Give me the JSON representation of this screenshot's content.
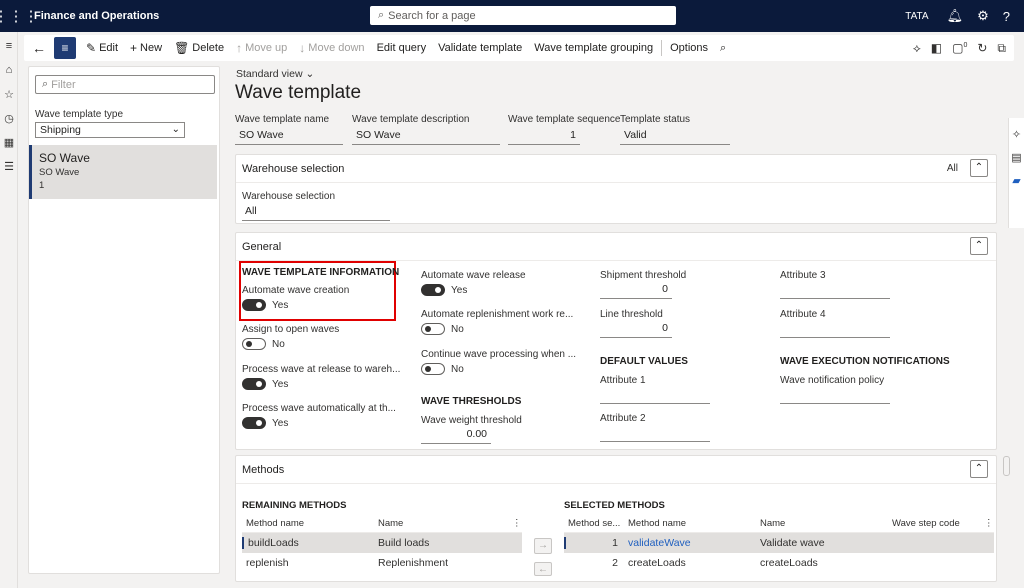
{
  "app": {
    "title": "Finance and Operations",
    "company": "TATA"
  },
  "search": {
    "placeholder": "Search for a page"
  },
  "actions": {
    "edit": "Edit",
    "new": "New",
    "delete": "Delete",
    "move_up": "Move up",
    "move_down": "Move down",
    "edit_query": "Edit query",
    "validate_template": "Validate template",
    "wave_template_grouping": "Wave template grouping",
    "options": "Options",
    "notification_count": "0"
  },
  "list": {
    "filter_placeholder": "Filter",
    "type_label": "Wave template type",
    "type_value": "Shipping",
    "items": [
      {
        "title": "SO Wave",
        "subtitle": "SO Wave",
        "sequence": "1"
      }
    ]
  },
  "header": {
    "view": "Standard view",
    "title": "Wave template",
    "fields": [
      {
        "label": "Wave template name",
        "value": "SO Wave"
      },
      {
        "label": "Wave template description",
        "value": "SO Wave"
      },
      {
        "label": "Wave template sequence",
        "value": "1"
      },
      {
        "label": "Template status",
        "value": "Valid"
      }
    ]
  },
  "warehouse": {
    "title": "Warehouse selection",
    "summary": "All",
    "field_label": "Warehouse selection",
    "field_value": "All"
  },
  "general": {
    "title": "General",
    "wave_template_information": "WAVE TEMPLATE INFORMATION",
    "automate_wave_creation": {
      "label": "Automate wave creation",
      "value": "Yes",
      "on": true
    },
    "assign_to_open_waves": {
      "label": "Assign to open waves",
      "value": "No",
      "on": false
    },
    "process_at_release": {
      "label": "Process wave at release to wareh...",
      "value": "Yes",
      "on": true
    },
    "process_automatically": {
      "label": "Process wave automatically at th...",
      "value": "Yes",
      "on": true
    },
    "automate_wave_release": {
      "label": "Automate wave release",
      "value": "Yes",
      "on": true
    },
    "automate_replenishment": {
      "label": "Automate replenishment work re...",
      "value": "No",
      "on": false
    },
    "continue_processing": {
      "label": "Continue wave processing when ...",
      "value": "No",
      "on": false
    },
    "wave_thresholds": "WAVE THRESHOLDS",
    "wave_weight_threshold": {
      "label": "Wave weight threshold",
      "value": "0.00"
    },
    "shipment_threshold": {
      "label": "Shipment threshold",
      "value": "0"
    },
    "line_threshold": {
      "label": "Line threshold",
      "value": "0"
    },
    "default_values": "DEFAULT VALUES",
    "attribute1": "Attribute 1",
    "attribute2": "Attribute 2",
    "attribute3": "Attribute 3",
    "attribute4": "Attribute 4",
    "wave_execution_notifications": "WAVE EXECUTION NOTIFICATIONS",
    "wave_notification_policy": "Wave notification policy"
  },
  "methods": {
    "title": "Methods",
    "remaining_title": "REMAINING METHODS",
    "remaining_columns": [
      "Method name",
      "Name"
    ],
    "remaining_rows": [
      [
        "buildLoads",
        "Build loads"
      ],
      [
        "replenish",
        "Replenishment"
      ]
    ],
    "selected_title": "SELECTED METHODS",
    "selected_columns": [
      "Method se...",
      "Method name",
      "Name",
      "Wave step code"
    ],
    "selected_rows": [
      [
        "1",
        "validateWave",
        "Validate wave",
        ""
      ],
      [
        "2",
        "createLoads",
        "createLoads",
        ""
      ]
    ]
  }
}
